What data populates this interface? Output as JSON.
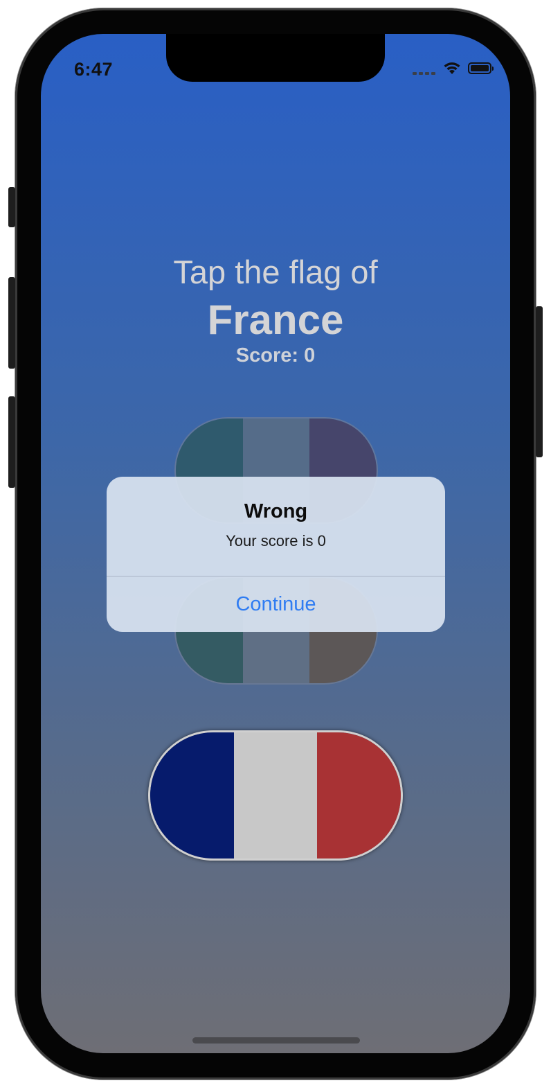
{
  "status_bar": {
    "time": "6:47",
    "signal_icon": "cellular-dots-icon",
    "wifi_icon": "wifi-icon",
    "battery_icon": "battery-icon",
    "battery_level": 1.0
  },
  "game": {
    "prompt": "Tap the flag of",
    "country": "France",
    "score_label": "Score: 0"
  },
  "flags": [
    {
      "name": "flag-option-1",
      "stripes": [
        "#2f5a6d",
        "#556c89",
        "#46456b"
      ]
    },
    {
      "name": "flag-option-2",
      "stripes": [
        "#345b63",
        "#5f6f85",
        "#5c5757"
      ]
    },
    {
      "name": "flag-option-france",
      "stripes": [
        "#061b6c",
        "#c8c8c8",
        "#a83234"
      ]
    }
  ],
  "alert": {
    "title": "Wrong",
    "message": "Your score is 0",
    "button": "Continue"
  },
  "colors": {
    "background_top": "#295fc5",
    "background_bottom": "#6e6e75",
    "alert_button": "#2f7cf2",
    "prompt_text": "#d4d4d6"
  }
}
